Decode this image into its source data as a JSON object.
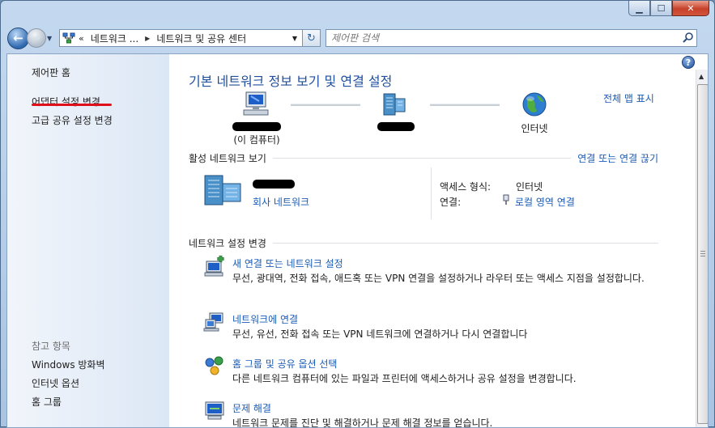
{
  "window": {
    "minimize_glyph": "▁",
    "maximize_glyph": "☐",
    "close_glyph": "✕"
  },
  "nav": {
    "back_glyph": "←",
    "forward_glyph": "→",
    "history_glyph": "▼"
  },
  "address": {
    "chevrons": "«",
    "segments": [
      "네트워크 ...",
      "네트워크 및 공유 센터"
    ],
    "separator_glyph": "▶",
    "dropdown_glyph": "▼",
    "refresh_glyph": "↻"
  },
  "search": {
    "placeholder": "제어판 검색",
    "icon": "search-icon"
  },
  "sidebar": {
    "home": "제어판 홈",
    "items": [
      "어댑터 설정 변경",
      "고급 공유 설정 변경"
    ],
    "see_also_heading": "참고 항목",
    "see_also": [
      "Windows 방화벽",
      "인터넷 옵션",
      "홈 그룹"
    ]
  },
  "main": {
    "title": "기본 네트워크 정보 보기 및 연결 설정",
    "map_link": "전체 맵 표시",
    "help_glyph": "?",
    "map": {
      "computer_sub": "(이 컴퓨터)",
      "internet": "인터넷"
    },
    "active": {
      "heading": "활성 네트워크 보기",
      "disconnect_link": "연결 또는 연결 끊기",
      "network_type": "회사 네트워크",
      "access_label": "액세스 형식:",
      "access_value": "인터넷",
      "connection_label": "연결:",
      "connection_value": "로컬 영역 연결"
    },
    "change": {
      "heading": "네트워크 설정 변경",
      "tasks": [
        {
          "title": "새 연결 또는 네트워크 설정",
          "desc": "무선, 광대역, 전화 접속, 애드혹 또는 VPN 연결을 설정하거나 라우터 또는 액세스 지점을 설정합니다."
        },
        {
          "title": "네트워크에 연결",
          "desc": "무선, 유선, 전화 접속 또는 VPN 네트워크에 연결하거나 다시 연결합니다"
        },
        {
          "title": "홈 그룹 및 공유 옵션 선택",
          "desc": "다른 네트워크 컴퓨터에 있는 파일과 프린터에 액세스하거나 공유 설정을 변경합니다."
        },
        {
          "title": "문제 해결",
          "desc": "네트워크 문제를 진단 및 해결하거나 문제 해결 정보를 얻습니다."
        }
      ]
    }
  },
  "colors": {
    "link": "#1a5bb5",
    "title": "#1e4f9e",
    "highlight_underline": "#e0101a"
  }
}
